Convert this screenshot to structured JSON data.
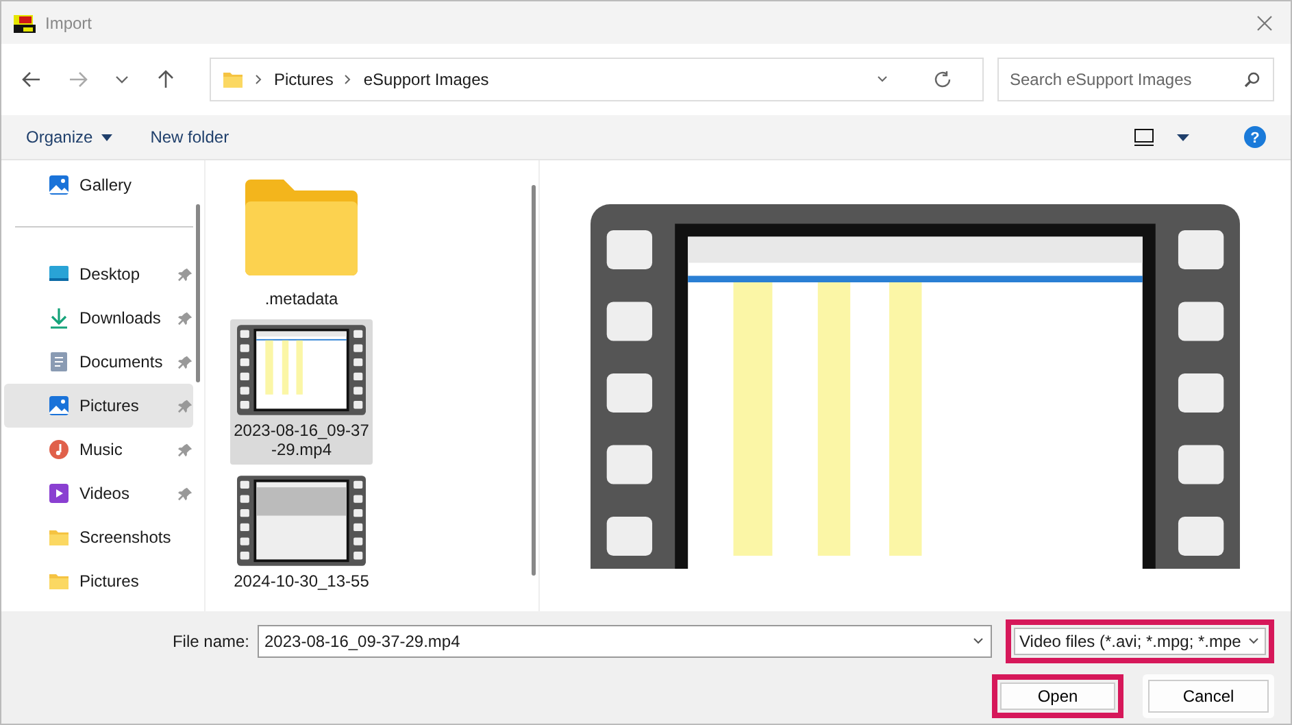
{
  "window": {
    "title": "Import"
  },
  "breadcrumb": [
    "Pictures",
    "eSupport Images"
  ],
  "search": {
    "placeholder": "Search eSupport Images"
  },
  "toolbar": {
    "organize": "Organize",
    "new_folder": "New folder"
  },
  "help": {
    "label": "?"
  },
  "sidebar": {
    "top": [
      {
        "label": "Gallery",
        "kind": "gallery",
        "pinned": false,
        "selected": false
      }
    ],
    "items": [
      {
        "label": "Desktop",
        "kind": "desktop",
        "pinned": true,
        "selected": false
      },
      {
        "label": "Downloads",
        "kind": "download",
        "pinned": true,
        "selected": false
      },
      {
        "label": "Documents",
        "kind": "document",
        "pinned": true,
        "selected": false
      },
      {
        "label": "Pictures",
        "kind": "gallery",
        "pinned": true,
        "selected": true
      },
      {
        "label": "Music",
        "kind": "music",
        "pinned": true,
        "selected": false
      },
      {
        "label": "Videos",
        "kind": "video",
        "pinned": true,
        "selected": false
      },
      {
        "label": "Screenshots",
        "kind": "folder",
        "pinned": false,
        "selected": false
      },
      {
        "label": "Pictures",
        "kind": "folder",
        "pinned": false,
        "selected": false
      }
    ]
  },
  "files": [
    {
      "name": ".metadata",
      "kind": "folder",
      "selected": false
    },
    {
      "name": "2023-08-16_09-37-29.mp4",
      "kind": "video",
      "selected": true
    },
    {
      "name": "2024-10-30_13-55",
      "kind": "video",
      "selected": false
    }
  ],
  "file_name": {
    "label": "File name:",
    "value": "2023-08-16_09-37-29.mp4"
  },
  "file_type": {
    "value": "Video files (*.avi; *.mpg; *.mpe",
    "highlighted": true
  },
  "buttons": [
    {
      "label": "Open",
      "highlighted": true
    },
    {
      "label": "Cancel",
      "highlighted": false
    }
  ]
}
